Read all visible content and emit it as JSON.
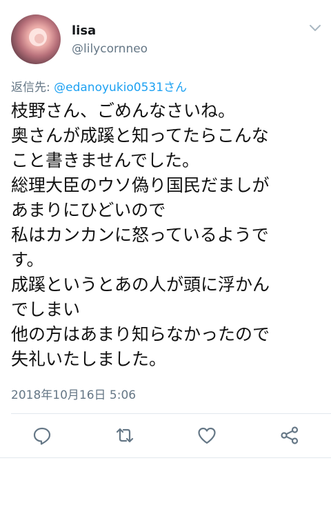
{
  "user": {
    "name": "lisa",
    "handle": "@lilycornneo",
    "avatar_icon": "rose-avatar"
  },
  "reply": {
    "label": "返信先: ",
    "mention": "@edanoyukio0531さん"
  },
  "tweet": {
    "lines": [
      "枝野さん、ごめんなさいね。",
      "奥さんが成蹊と知ってたらこんな",
      "こと書きませんでした。",
      "総理大臣のウソ偽り国民だましが",
      "あまりにひどいので",
      "私はカンカンに怒っているようで",
      "す。",
      "成蹊というとあの人が頭に浮かん",
      "でしまい",
      "他の方はあまり知らなかったので",
      "失礼いたしました。"
    ]
  },
  "timestamp": "2018年10月16日 5:06",
  "actions": [
    "reply-icon",
    "retweet-icon",
    "like-icon",
    "share-icon"
  ],
  "colors": {
    "text": "#14171a",
    "secondary": "#657786",
    "link": "#1da1f2",
    "divider": "#e1e8ed"
  }
}
